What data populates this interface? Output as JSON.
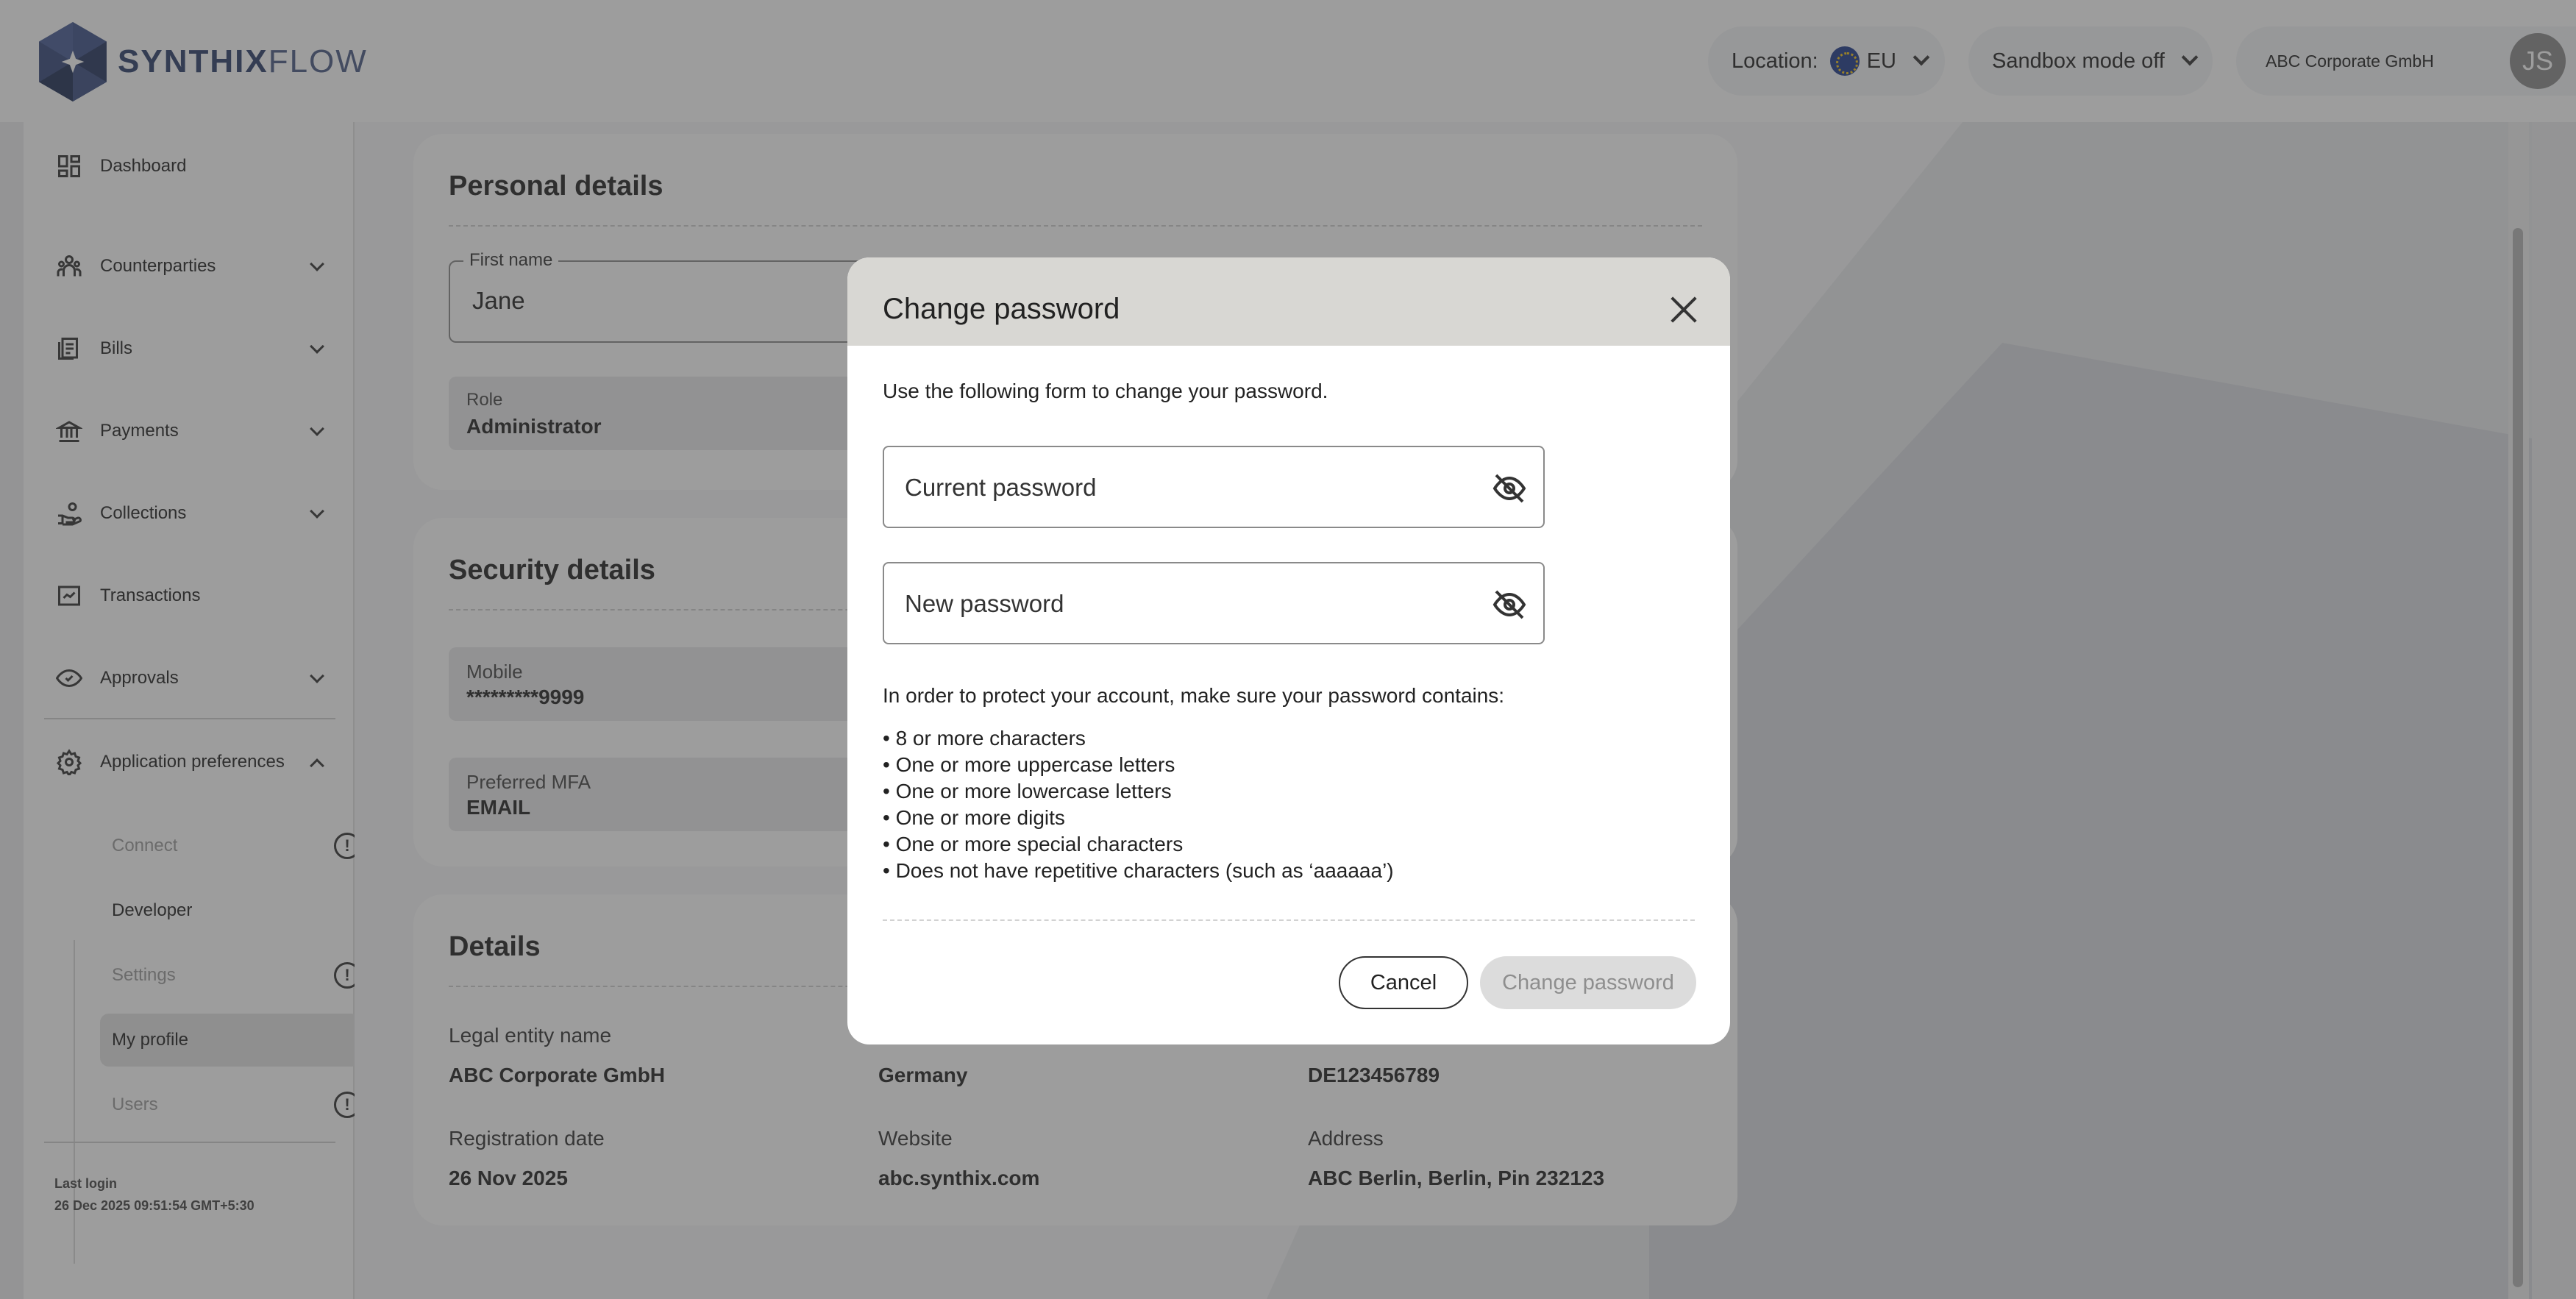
{
  "brand": {
    "logo_text_bold": "SYNTHIX",
    "logo_text_light": "FLOW"
  },
  "header": {
    "location_label": "Location:",
    "location_value": "EU",
    "sandbox_label": "Sandbox mode off",
    "company_name": "ABC Corporate GmbH",
    "avatar_initials": "JS"
  },
  "sidebar": {
    "items": [
      {
        "label": "Dashboard",
        "icon": "dashboard-icon"
      },
      {
        "label": "Counterparties",
        "icon": "people-icon"
      },
      {
        "label": "Bills",
        "icon": "bills-icon"
      },
      {
        "label": "Payments",
        "icon": "bank-icon"
      },
      {
        "label": "Collections",
        "icon": "hand-coins-icon"
      },
      {
        "label": "Transactions",
        "icon": "transactions-icon"
      },
      {
        "label": "Approvals",
        "icon": "eye-check-icon"
      },
      {
        "label": "Application preferences",
        "icon": "gear-icon"
      }
    ],
    "sub_items": [
      {
        "label": "Connect",
        "warning": true
      },
      {
        "label": "Developer",
        "warning": false
      },
      {
        "label": "Settings",
        "warning": true
      },
      {
        "label": "My profile",
        "warning": false
      },
      {
        "label": "Users",
        "warning": true
      }
    ],
    "warning_glyph": "!",
    "last_login_label": "Last login",
    "last_login_value": "26 Dec 2025 09:51:54 GMT+5:30"
  },
  "personal": {
    "title": "Personal details",
    "first_name_label": "First name",
    "first_name_value": "Jane",
    "role_label": "Role",
    "role_value": "Administrator"
  },
  "security": {
    "title": "Security details",
    "mobile_label": "Mobile",
    "mobile_value": "*********9999",
    "mfa_label": "Preferred MFA",
    "mfa_value": "EMAIL"
  },
  "details": {
    "title": "Details",
    "legal_entity_label": "Legal entity name",
    "legal_entity_value": "ABC Corporate GmbH",
    "country_value": "Germany",
    "tax_value": "DE123456789",
    "reg_date_label": "Registration date",
    "reg_date_value": "26 Nov 2025",
    "website_label": "Website",
    "website_value": "abc.synthix.com",
    "address_label": "Address",
    "address_value": "ABC Berlin, Berlin, Pin 232123"
  },
  "modal": {
    "title": "Change password",
    "intro": "Use the following form to change your password.",
    "current_password_placeholder": "Current password",
    "new_password_placeholder": "New password",
    "rules_intro": "In order to protect your account, make sure your password contains:",
    "rules": [
      "• 8 or more characters",
      "• One or more uppercase letters",
      "• One or more lowercase letters",
      "• One or more digits",
      "• One or more special characters",
      "• Does not have repetitive characters (such as ‘aaaaaa’)"
    ],
    "cancel_label": "Cancel",
    "submit_label": "Change password"
  }
}
